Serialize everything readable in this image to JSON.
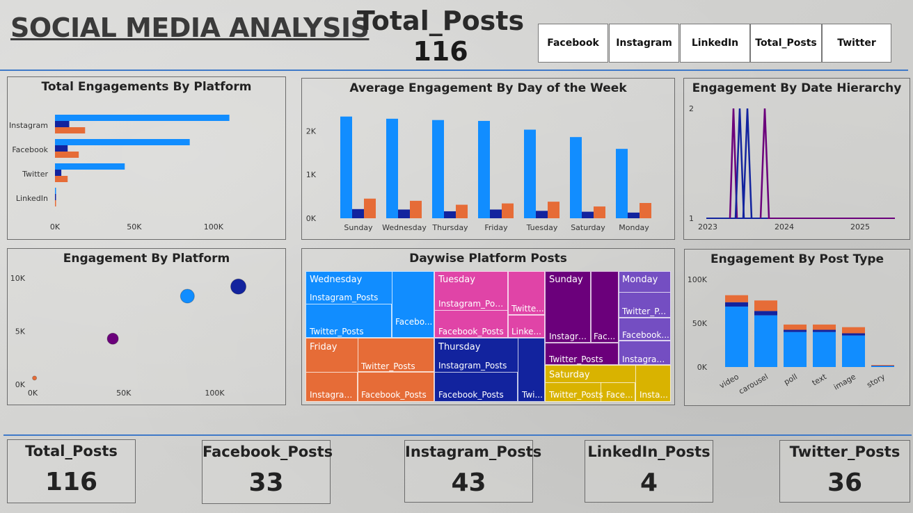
{
  "header": {
    "title": "SOCIAL MEDIA ANALYSIS",
    "total_posts_label": "Total_Posts",
    "total_posts_value": "116"
  },
  "slicers": [
    "Facebook",
    "Instagram",
    "LinkedIn",
    "Total_Posts",
    "Twitter"
  ],
  "colors": {
    "blue": "#118dff",
    "navy": "#12239e",
    "orange": "#e66c37",
    "purple": "#6b007b",
    "magenta": "#e044a7",
    "violet": "#744ec2",
    "gold": "#d9b300"
  },
  "charts": {
    "platform_bar": {
      "title": "Total Engagements By Platform",
      "type": "bar",
      "orientation": "horizontal",
      "categories": [
        "Instagram",
        "Facebook",
        "Twitter",
        "LinkedIn"
      ],
      "series": [
        {
          "values": [
            110000,
            85000,
            44000,
            500
          ]
        },
        {
          "values": [
            9000,
            8000,
            4000,
            200
          ]
        },
        {
          "values": [
            19000,
            15000,
            8000,
            300
          ]
        }
      ],
      "xticks": [
        "0K",
        "50K",
        "100K"
      ],
      "xlim": [
        0,
        115000
      ]
    },
    "day_bar": {
      "title": "Average Engagement By Day of the Week",
      "type": "bar",
      "categories": [
        "Sunday",
        "Wednesday",
        "Thursday",
        "Friday",
        "Tuesday",
        "Saturday",
        "Monday"
      ],
      "series": [
        {
          "values": [
            2330,
            2280,
            2250,
            2230,
            2030,
            1860,
            1590
          ]
        },
        {
          "values": [
            210,
            200,
            160,
            200,
            170,
            150,
            130
          ]
        },
        {
          "values": [
            450,
            400,
            310,
            340,
            380,
            270,
            350
          ]
        }
      ],
      "yticks": [
        "0K",
        "1K",
        "2K"
      ],
      "ylim": [
        0,
        2500
      ]
    },
    "date_line": {
      "title": "Engagement By Date Hierarchy",
      "type": "line",
      "xticks": [
        "2023",
        "2024",
        "2025"
      ],
      "yticks": [
        "1",
        "2"
      ],
      "ylim": [
        1,
        2
      ]
    },
    "scatter": {
      "title": "Engagement By Platform",
      "type": "scatter",
      "points": [
        {
          "x": 1000,
          "y": 600
        },
        {
          "x": 44000,
          "y": 4300
        },
        {
          "x": 85000,
          "y": 8300
        },
        {
          "x": 113000,
          "y": 9200
        }
      ],
      "xticks": [
        "0K",
        "50K",
        "100K"
      ],
      "yticks": [
        "0K",
        "5K",
        "10K"
      ],
      "xlim": [
        0,
        130000
      ],
      "ylim": [
        0,
        10000
      ]
    },
    "treemap": {
      "title": "Daywise Platform Posts",
      "groups": [
        {
          "name": "Wednesday",
          "labels": [
            "Instagram_Posts",
            "Twitter_Posts",
            "Facebo..."
          ]
        },
        {
          "name": "Tuesday",
          "labels": [
            "Instagram_Posts",
            "Facebook_Posts",
            "Twitte...",
            "Linke..."
          ]
        },
        {
          "name": "Sunday",
          "labels": [
            "Instagra...",
            "Fac...",
            "Twitter_Posts"
          ]
        },
        {
          "name": "Monday",
          "labels": [
            "Twitter_P...",
            "Facebook...",
            "Instagram..."
          ]
        },
        {
          "name": "Friday",
          "labels": [
            "Twitter_Posts",
            "Instagram...",
            "Facebook_Posts"
          ]
        },
        {
          "name": "Thursday",
          "labels": [
            "Instagram_Posts",
            "Facebook_Posts",
            "Twi..."
          ]
        },
        {
          "name": "Saturday",
          "labels": [
            "Twitter_Posts",
            "Face...",
            "Insta..."
          ]
        }
      ]
    },
    "post_type": {
      "title": "Engagement By Post Type",
      "type": "bar",
      "stacked": true,
      "categories": [
        "video",
        "carousel",
        "poll",
        "text",
        "image",
        "story"
      ],
      "series": [
        {
          "values": [
            69000,
            59000,
            40000,
            40000,
            36000,
            1800
          ]
        },
        {
          "values": [
            5000,
            5000,
            2500,
            2500,
            2500,
            200
          ]
        },
        {
          "values": [
            8000,
            12000,
            6000,
            6000,
            7000,
            300
          ]
        }
      ],
      "yticks": [
        "0K",
        "50K",
        "100K"
      ],
      "ylim": [
        0,
        100000
      ]
    }
  },
  "kpis": [
    {
      "label": "Total_Posts",
      "value": "116"
    },
    {
      "label": "Facebook_Posts",
      "value": "33"
    },
    {
      "label": "Instagram_Posts",
      "value": "43"
    },
    {
      "label": "LinkedIn_Posts",
      "value": "4"
    },
    {
      "label": "Twitter_Posts",
      "value": "36"
    }
  ]
}
